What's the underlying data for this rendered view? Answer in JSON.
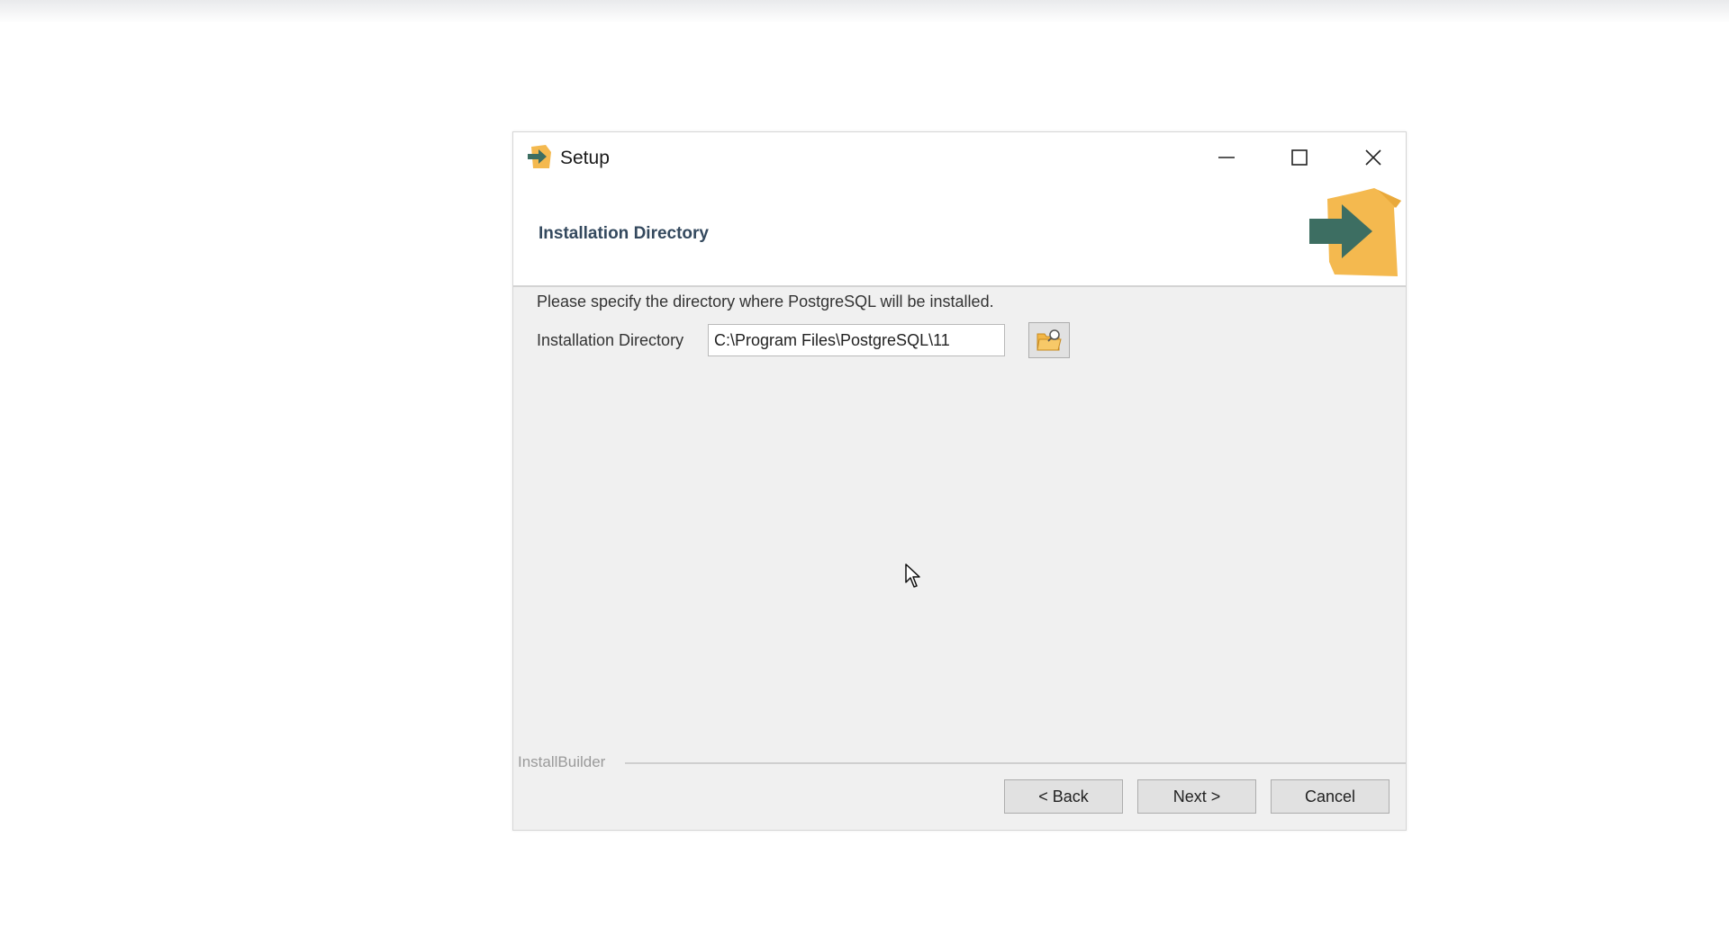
{
  "window": {
    "title": "Setup",
    "header_title": "Installation Directory",
    "controls": {
      "minimize": "minimize-icon",
      "maximize": "maximize-icon",
      "close": "close-icon"
    }
  },
  "content": {
    "description": "Please specify the directory where PostgreSQL will be installed.",
    "directory_label": "Installation Directory",
    "directory_value": "C:\\Program Files\\PostgreSQL\\11",
    "browse_icon": "folder-open-icon"
  },
  "footer": {
    "brand": "InstallBuilder",
    "back_label": "< Back",
    "next_label": "Next >",
    "cancel_label": "Cancel"
  },
  "colors": {
    "accent_orange": "#f4b94f",
    "accent_green": "#3d6e62",
    "header_text": "#34495e"
  }
}
